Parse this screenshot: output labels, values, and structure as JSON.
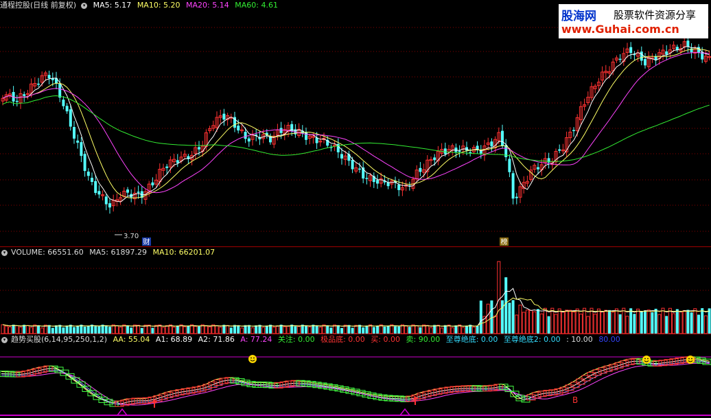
{
  "price_header": {
    "title": "通程控股(日线 前复权)",
    "ma5": "MA5: 5.17",
    "ma10": "MA10: 5.20",
    "ma20": "MA20: 5.14",
    "ma60": "MA60: 4.61"
  },
  "volume_header": {
    "volume": "VOLUME: 66551.60",
    "ma5": "MA5: 61897.29",
    "ma10": "MA10: 66201.07"
  },
  "indicator_header": {
    "name": "趋势买股(6,14,95,250,1,2)",
    "aa": "AA: 55.04",
    "a1": "A1: 68.89",
    "a2": "A2: 71.86",
    "a": "A: 77.24",
    "guanzhu": "关注: 0.00",
    "jipindi": "极品底: 0.00",
    "mai": "买: 0.00",
    "sell": "卖: 90.00",
    "zhizun": "至尊绝底: 0.00",
    "zhizun2": "至尊绝底2: 0.00",
    "v10": ": 10.00",
    "v80": "80.00"
  },
  "watermark": {
    "brand": "股海网",
    "tagline": "股票软件资源分享",
    "url": "www.Guhai.com.cn"
  },
  "annotations": {
    "low_price": "3.70",
    "cai_tag": "财",
    "bang_tag": "榜",
    "b_marker": "B"
  },
  "colors": {
    "up": "#ff3232",
    "down": "#54ffff",
    "ma5": "#ffffff",
    "ma10": "#ffff66",
    "ma20": "#ff44ff",
    "ma60": "#33ee33",
    "grid": "#8b0000",
    "separator": "#a00000",
    "guide": "#cc00cc",
    "vol_ma5": "#ffffff",
    "vol_ma10": "#ffff66",
    "ind_yellow": "#ffff66",
    "ind_white": "#ffffff",
    "ind_blue": "#8888ff",
    "ind_magenta": "#ff44ff",
    "smiley": "#ffd700"
  },
  "chart_data": [
    {
      "type": "candlestick",
      "title": "通程控股(日线 前复权)",
      "ylim": [
        3.5,
        6.3
      ],
      "series": [
        {
          "name": "MA5",
          "values": [
            5.17
          ]
        },
        {
          "name": "MA10",
          "values": [
            5.2
          ]
        },
        {
          "name": "MA20",
          "values": [
            5.14
          ]
        },
        {
          "name": "MA60",
          "values": [
            4.61
          ]
        }
      ],
      "annotations": [
        "3.70"
      ]
    },
    {
      "type": "bar",
      "title": "VOLUME",
      "series": [
        {
          "name": "VOLUME",
          "values": [
            66551.6
          ]
        },
        {
          "name": "MA5",
          "values": [
            61897.29
          ]
        },
        {
          "name": "MA10",
          "values": [
            66201.07
          ]
        }
      ]
    },
    {
      "type": "line",
      "title": "趋势买股(6,14,95,250,1,2)",
      "series": [
        {
          "name": "AA",
          "values": [
            55.04
          ]
        },
        {
          "name": "A1",
          "values": [
            68.89
          ]
        },
        {
          "name": "A2",
          "values": [
            71.86
          ]
        },
        {
          "name": "A",
          "values": [
            77.24
          ]
        }
      ]
    }
  ]
}
